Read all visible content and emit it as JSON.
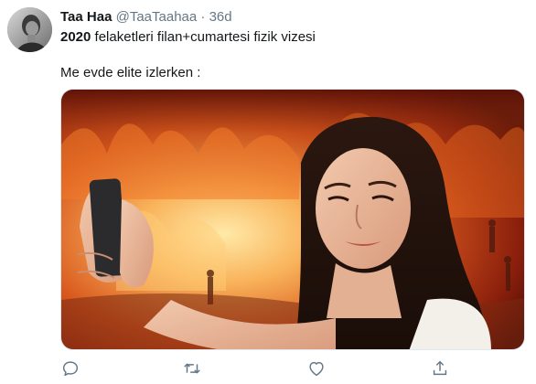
{
  "tweet": {
    "display_name": "Taa Haa",
    "handle": "@TaaTaahaa",
    "separator": "·",
    "time": "36d",
    "line1_bold": "2020",
    "line1_rest": " felaketleri filan+cumartesi fizik vizesi",
    "line2": "Me evde elite izlerken :"
  },
  "actions": {
    "icons": [
      "reply-icon",
      "retweet-icon",
      "like-icon",
      "share-icon"
    ]
  },
  "colors": {
    "text": "#14171a",
    "muted": "#657786",
    "icon": "#657786",
    "border": "#e1e8ed"
  }
}
